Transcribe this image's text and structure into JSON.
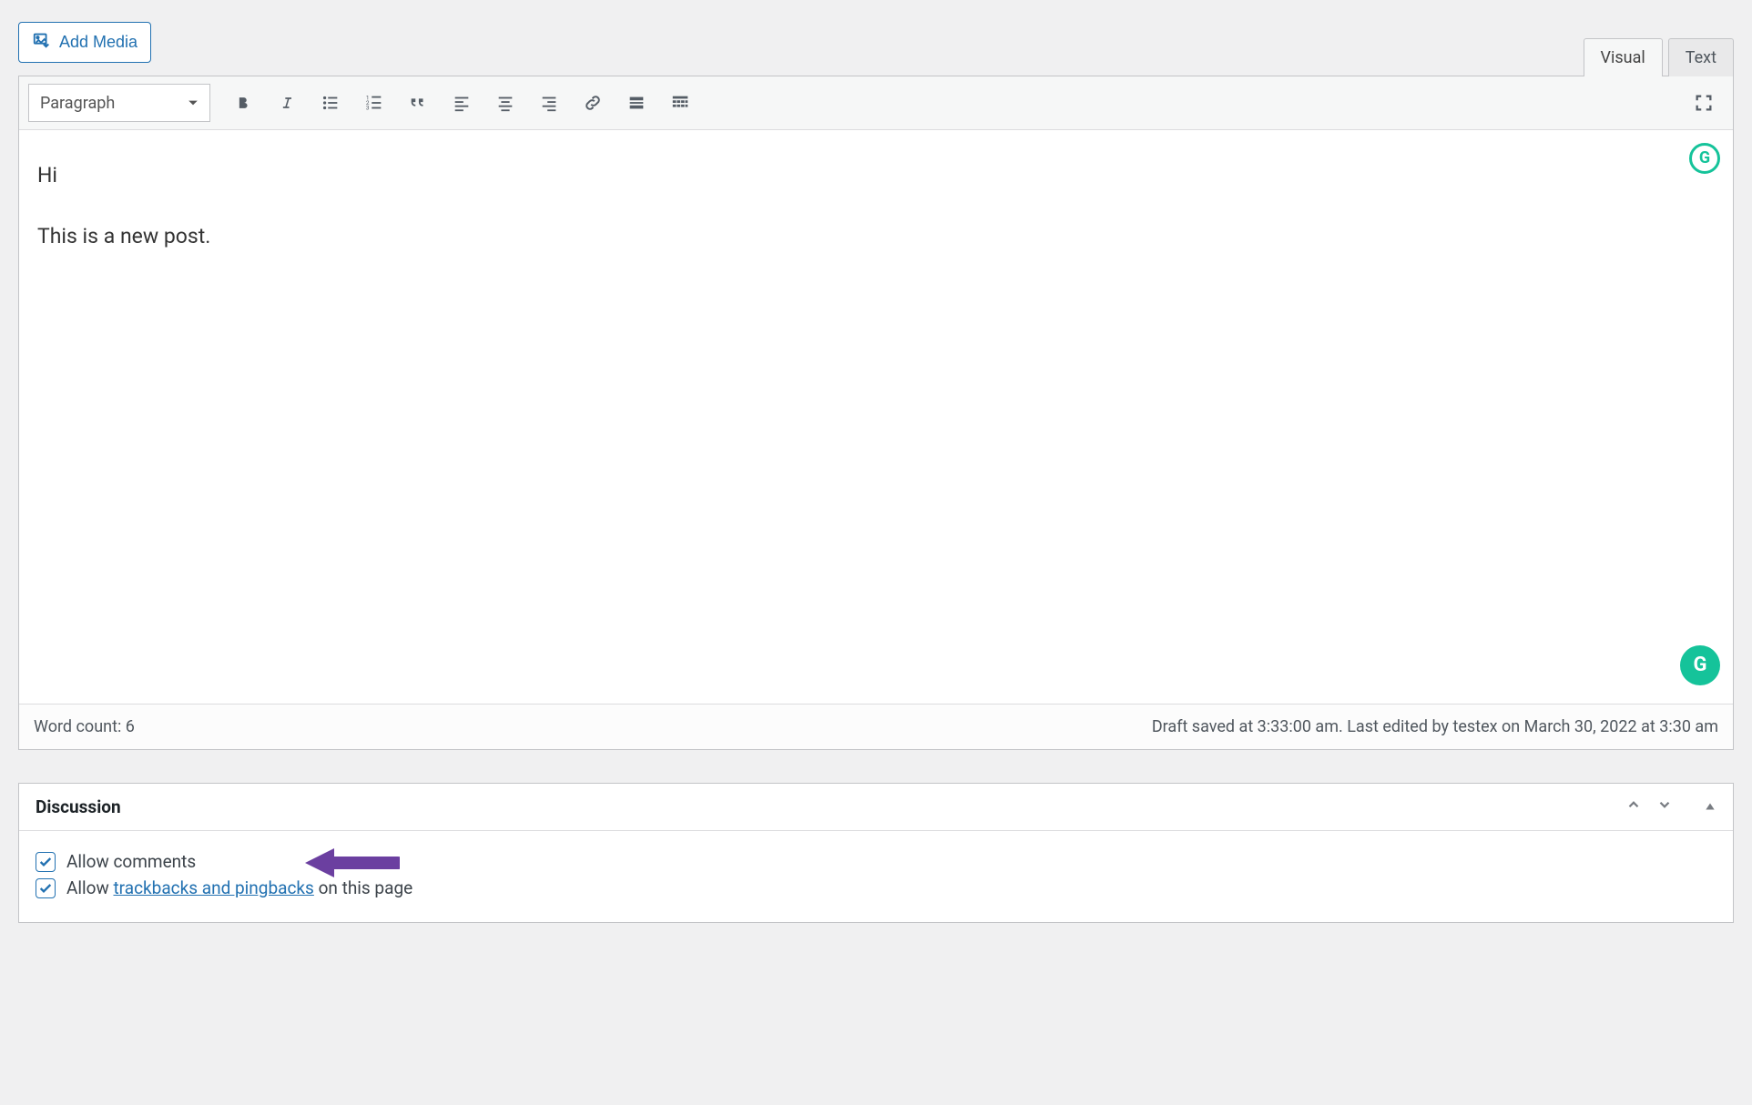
{
  "toolbar": {
    "add_media_label": "Add Media",
    "paragraph_label": "Paragraph"
  },
  "tabs": {
    "visual": "Visual",
    "text": "Text"
  },
  "content": {
    "line1": "Hi",
    "line2": "This is a new post."
  },
  "status": {
    "word_count_label": "Word count: ",
    "word_count_value": "6",
    "saved_text": "Draft saved at 3:33:00 am. Last edited by testex on March 30, 2022 at 3:30 am"
  },
  "discussion": {
    "title": "Discussion",
    "allow_comments": "Allow comments",
    "allow_prefix": "Allow ",
    "trackbacks_link": "trackbacks and pingbacks",
    "allow_suffix": " on this page"
  }
}
